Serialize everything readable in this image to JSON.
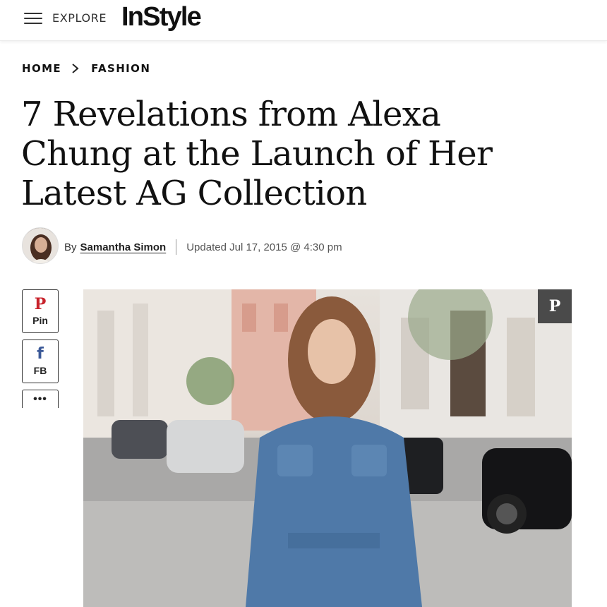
{
  "header": {
    "explore_label": "EXPLORE",
    "logo_text": "InStyle"
  },
  "breadcrumb": {
    "items": [
      "HOME",
      "FASHION"
    ]
  },
  "article": {
    "title": "7 Revelations from Alexa Chung at the Launch of Her Latest AG Collection",
    "byline_prefix": "By",
    "author": "Samantha Simon",
    "updated": "Updated Jul 17, 2015 @ 4:30 pm"
  },
  "share": {
    "pin_icon": "P",
    "pin_label": "Pin",
    "fb_icon": "f",
    "fb_label": "FB",
    "more_label": "•••"
  },
  "hero": {
    "pin_icon": "P"
  },
  "colors": {
    "pinterest": "#c8232c",
    "facebook": "#3b5998",
    "denim": "#4f79a8",
    "pin_overlay": "#4a4a4a"
  }
}
